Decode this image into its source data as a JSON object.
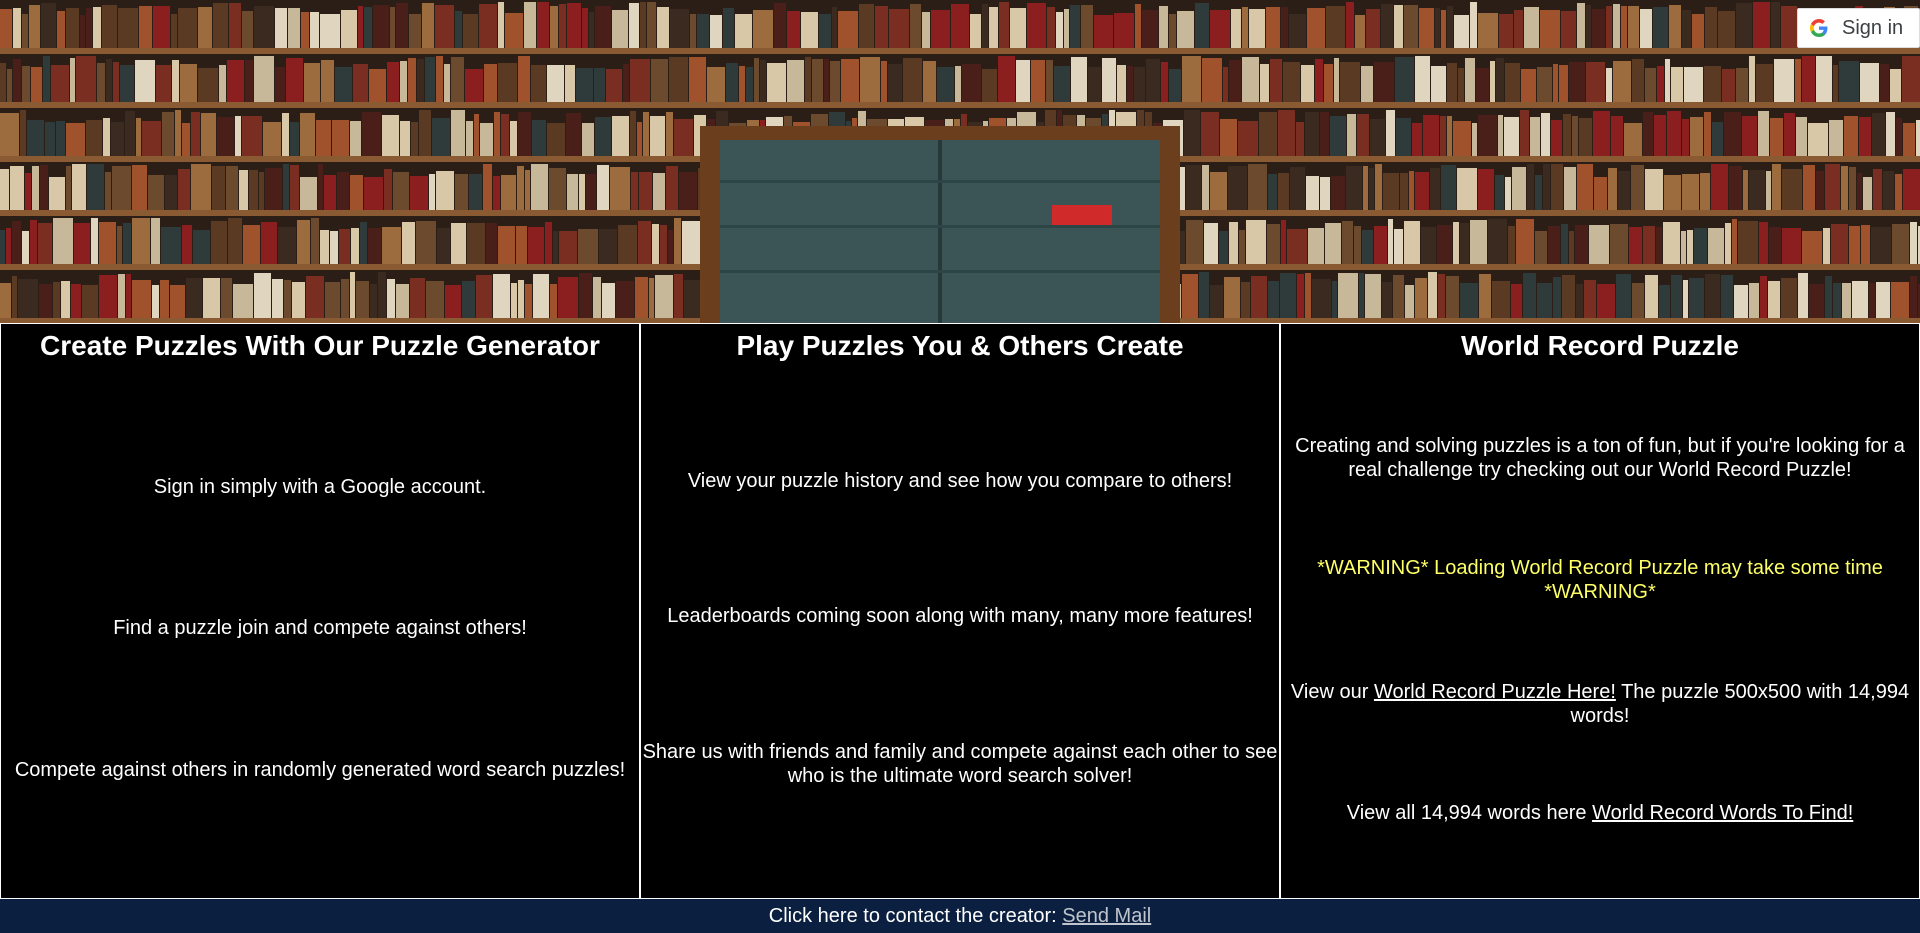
{
  "header": {
    "signin_label": "Sign in"
  },
  "columns": [
    {
      "title": "Create Puzzles With Our Puzzle Generator",
      "lines": [
        "Sign in simply with a Google account.",
        "Find a puzzle join and compete against others!",
        "Compete against others in randomly generated word search puzzles!"
      ]
    },
    {
      "title": "Play Puzzles You & Others Create",
      "lines": [
        "View your puzzle history and see how you compare to others!",
        "Leaderboards coming soon along with many, many more features!",
        "Share us with friends and family and compete against each other to see who is the ultimate word search solver!"
      ]
    },
    {
      "title": "World Record Puzzle",
      "intro": "Creating and solving puzzles is a ton of fun, but if you're looking for a real challenge try checking out our World Record Puzzle!",
      "warning": "*WARNING* Loading World Record Puzzle may take some time *WARNING*",
      "view_prefix": "View our ",
      "puzzle_link": "World Record Puzzle Here!",
      "view_suffix": " The puzzle 500x500 with 14,994 words!",
      "words_prefix": "View all 14,994 words here ",
      "words_link": "World Record Words To Find!"
    }
  ],
  "footer": {
    "text": "Click here to contact the creator: ",
    "link": "Send Mail"
  },
  "colors": {
    "background": "#000000",
    "warning": "#ffff66",
    "footer": "#0b2040",
    "door": "#3b5455"
  }
}
